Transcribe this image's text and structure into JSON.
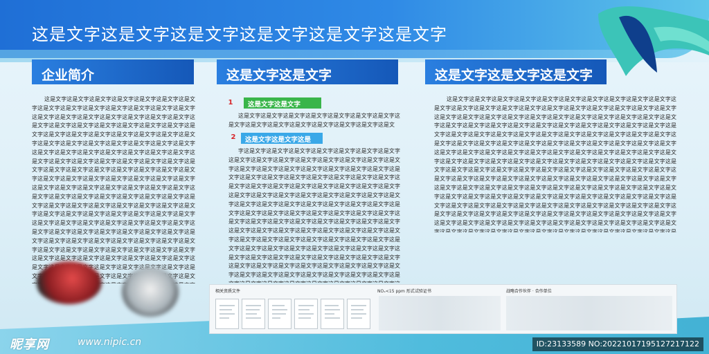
{
  "header": {
    "title": "这是文字这是文字这是文字这是文字这是文字这是文字"
  },
  "colors": {
    "banner": "#1f6fd6",
    "section_header": "#1558b8",
    "tag_green": "#39b54a",
    "tag_blue": "#3aa8e8",
    "number_red": "#d7262b"
  },
  "sections": {
    "company": {
      "title": "企业简介",
      "body": "这是文字这是文字这是文字这是文字这是文字这是文字这是文字这是文字这是文字这是文字这是文字这是文字这是文字这是文字这是文字这是文字这是文字这是文字这是文字这是文字这是文字这是文字这是文字这是文字这是文字这是文字这是文字这是文字这是文字这是文字这是文字这是文字这是文字这是文字这是文字这是文字这是文字这是文字这是文字这是文字这是文字这是文字这是文字这是文字这是文字这是文字这是文字这是文字这是文字这是文字这是文字这是文字这是文字这是文字这是文字这是文字这是文字这是文字这是文字这是文字这是文字这是文字这是文字这是文字这是文字这是文字这是文字这是文字这是文字这是文字这是文字这是文字这是文字这是文字这是文字这是文字这是文字这是文字这是文字这是文字这是文字这是文字这是文字这是文字这是文字这是文字这是文字这是文字这是文字这是文字这是文字这是文字这是文字这是文字这是文字这是文字这是文字这是文字这是文字这是文字这是文字这是文字这是文字这是文字这是文字这是文字这是文字这是文字这是文字这是文字这是文字这是文字这是文字这是文字这是文字这是文字这是文字这是文字这是文字这是文字这是文字这是文字这是文字这是文字这是文字这是文字这是文字这是文字这是文字这是文字这是文字这是文字这是文字这是文字这是文字这是文字这是文字这是文字这是文字这是文字这是文字这是文字这是文字这是文字这是文字这是文字这是文字这是文字这是文字这是文字这是文字这是文字这是文字这是文字这是文字这是文字这是文字这是文字这是文字这是文字这是文字这是文字这是文字这是文字这是文字这是文字这是文字这是文字这是文字这是文字这是文字这是文字这是文字这是文字这是文字这是文字这是文字这是文字这是文字这是文字这是文字这是文字这是文字这是文字这是文字这是文字这是文字这是文字这是文字这是文字这是文字这是文字这是文字这是文字这是文字这是文字这是文字这是文字这是文字这是文字这是文字这是文字这是文字这是文字这是文字这是文字这是文字这是文字这是文字这是文字这是文字这是文字这是文字这是文字这是文字这是文字"
    },
    "middle": {
      "title": "这是文字这是文字",
      "item1": {
        "number": "1",
        "tag": "这是文字这是文字",
        "body": "这是文字这是文字这是文字这是文字这是文字这是文字这是文字这是文字这是文字这是文字这是文字这是文字这是文字这是文字这是文"
      },
      "item2": {
        "number": "2",
        "tag": "这是文字这是文字这是",
        "body": "字这是文字这是文字这是文字这是文字这是文字这是文字这是文字这是文字这是文字这是文字这是文字这是文字这是文字这是文字这是文字这是文字这是文字这是文字这是文字这是文字这是文字这是文字这是文字这是文字这是文字这是文字这是文字这是文字这是文字这是文字这是文字这是文字这是文字这是文字这是文字这是文字这是文字这是文字这是文字这是文字这是文字这是文字这是文字这是文字这是文字这是文字这是文字这是文字这是文字这是文字这是文字这是文字这是文字这是文字这是文字这是文字这是文字这是文字这是文字这是文字这是文字这是文字这是文字这是文字这是文字这是文字这是文字这是文字这是文字这是文字这是文字这是文字这是文字这是文字这是文字这是文字这是文字这是文字这是文字这是文字这是文字这是文字这是文字这是文字这是文字这是文字这是文字这是文字这是文字这是文字这是文字这是文字这是文字这是文字这是文字这是文字这是文字这是文字这是文字这是文字这是文字这是文字这是文字这是文字这是文字这是文字这是文字这是文字这是文字这是文字这是文字这是文字这是文字这是文字这是文字这是文字这是文字这是文字这是文字这是文字这是文字这是文字这是文字这是文字这是文字这是文字这是文字这是文字这是文字这是文字这是文字这是文字这是文字这是文字这是文字这是文字这是文字这是文字这是文字这是文字这是文字这是文字这是文字这是文字这是文字这是文字这是文字这是文字这是文字这是文字这是文字这是文字这是文字这是文字这是文字"
      }
    },
    "right": {
      "title": "这是文字这是文字这是文字",
      "body": "这是文字这是文字这是文字这是文字这是文字这是文字这是文字这是文字这是文字这是文字这是文字这是文字这是文字这是文字这是文字这是文字这是文字这是文字这是文字这是文字这是文字这是文字这是文字这是文字这是文字这是文字这是文字这是文字这是文字这是文字这是文字这是文字这是文字这是文字这是文字这是文字这是文字这是文字这是文字这是文字这是文字这是文字这是文字这是文字这是文字这是文字这是文字这是文字这是文字这是文字这是文字这是文字这是文字这是文字这是文字这是文字这是文字这是文字这是文字这是文字这是文字这是文字这是文字这是文字这是文字这是文字这是文字这是文字这是文字这是文字这是文字这是文字这是文字这是文字这是文字这是文字这是文字这是文字这是文字这是文字这是文字这是文字这是文字这是文字这是文字这是文字这是文字这是文字这是文字这是文字这是文字这是文字这是文字这是文字这是文字这是文字这是文字这是文字这是文字这是文字这是文字这是文字这是文字这是文字这是文字这是文字这是文字这是文字这是文字这是文字这是文字这是文字这是文字这是文字这是文字这是文字这是文字这是文字这是文字这是文字这是文字这是文字这是文字这是文字这是文字这是文字这是文字这是文字这是文字这是文字这是文字这是文字这是文字这是文字这是文字这是文字这是文字这是文字这是文字这是文字这是文字这是文字这是文字这是文字这是文字这是文字这是文字这是文字这是文字这是文字这是文字这是文字这是文字这是文字这是文字这是文字这是文字这是文字这是文字这是文字这是文字这是文字这是文字这是文字这是文字这是文字这是文字这是文字这是文字这是文字这是文字这是文字这是文字这是文字这是文字这是文字这是文字这是文字"
    }
  },
  "certificates": {
    "label_left": "相关资质文件",
    "label_middle": "NOₓ<15 ppm 形式试验证书",
    "label_right": "战略合作伙伴 · 合作单位"
  },
  "watermark": {
    "logo": "昵享网",
    "url": "www.nipic.cn",
    "id": "ID:23133589 NO:20221017195127217122"
  }
}
